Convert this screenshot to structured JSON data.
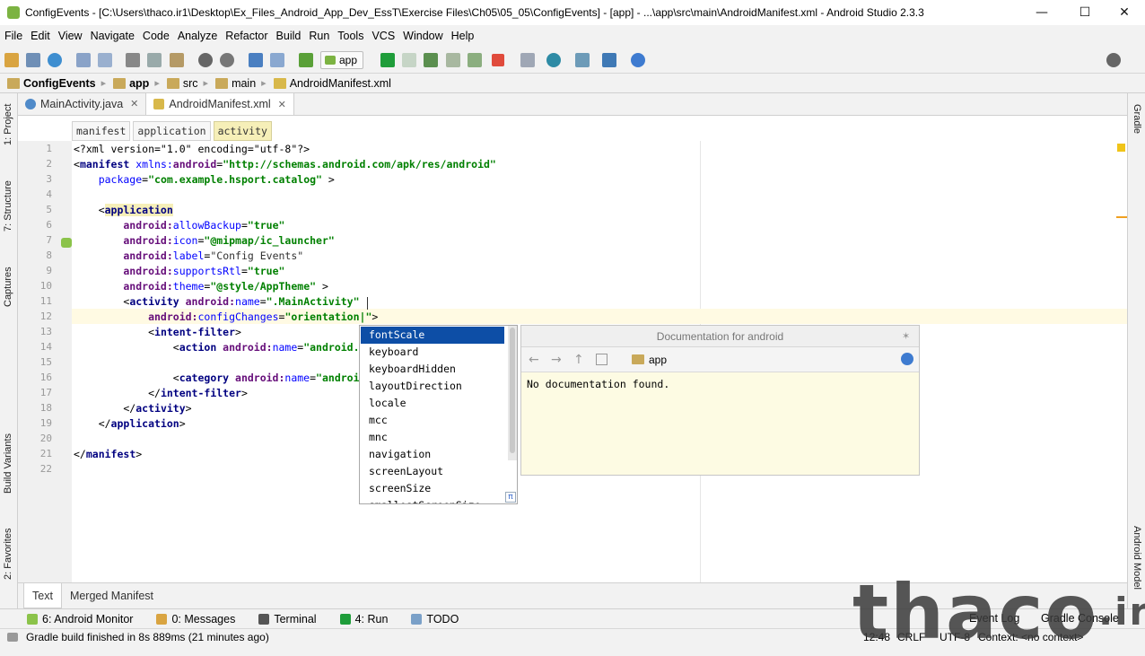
{
  "window": {
    "title": "ConfigEvents - [C:\\Users\\thaco.ir1\\Desktop\\Ex_Files_Android_App_Dev_EssT\\Exercise Files\\Ch05\\05_05\\ConfigEvents] - [app] - ...\\app\\src\\main\\AndroidManifest.xml - Android Studio 2.3.3",
    "minimize": "—",
    "maximize": "☐",
    "close": "✕"
  },
  "menu": [
    "File",
    "Edit",
    "View",
    "Navigate",
    "Code",
    "Analyze",
    "Refactor",
    "Build",
    "Run",
    "Tools",
    "VCS",
    "Window",
    "Help"
  ],
  "toolbar": {
    "run_config": "app"
  },
  "breadcrumbs": [
    "ConfigEvents",
    "app",
    "src",
    "main",
    "AndroidManifest.xml"
  ],
  "left_strip": {
    "project": "1: Project",
    "structure": "7: Structure",
    "captures": "Captures",
    "build_variants": "Build Variants",
    "favorites": "2: Favorites"
  },
  "right_strip": {
    "gradle": "Gradle",
    "android_model": "Android Model"
  },
  "editor_tabs": [
    {
      "label": "MainActivity.java",
      "active": false
    },
    {
      "label": "AndroidManifest.xml",
      "active": true
    }
  ],
  "xml_crumbs": [
    "manifest",
    "application",
    "activity"
  ],
  "line_numbers": [
    "1",
    "2",
    "3",
    "4",
    "5",
    "6",
    "7",
    "8",
    "9",
    "10",
    "11",
    "12",
    "13",
    "14",
    "15",
    "16",
    "17",
    "18",
    "19",
    "20",
    "21",
    "22"
  ],
  "code": {
    "l1a": "<?xml version=\"1.0\" encoding=\"utf-8\"?>",
    "l2a": "<",
    "l2b": "manifest",
    "l2c": " xmlns:",
    "l2d": "android",
    "l2e": "=",
    "l2f": "\"http://schemas.android.com/apk/res/android\"",
    "l3a": "    package",
    "l3b": "=",
    "l3c": "\"com.example.hsport.catalog\"",
    "l3d": " >",
    "l5a": "    <",
    "l5b": "application",
    "l6a": "        android:",
    "l6b": "allowBackup",
    "l6c": "=",
    "l6d": "\"true\"",
    "l7a": "        android:",
    "l7b": "icon",
    "l7c": "=",
    "l7d": "\"@mipmap/ic_launcher\"",
    "l8a": "        android:",
    "l8b": "label",
    "l8c": "=",
    "l8d": "\"Config Events\"",
    "l9a": "        android:",
    "l9b": "supportsRtl",
    "l9c": "=",
    "l9d": "\"true\"",
    "l10a": "        android:",
    "l10b": "theme",
    "l10c": "=",
    "l10d": "\"@style/AppTheme\"",
    "l10e": " >",
    "l11a": "        <",
    "l11b": "activity",
    "l11c": " android:",
    "l11d": "name",
    "l11e": "=",
    "l11f": "\".MainActivity\"",
    "l12a": "            android:",
    "l12b": "configChanges",
    "l12c": "=",
    "l12d": "\"orientation|\"",
    "l12e": ">",
    "l13a": "            <",
    "l13b": "intent-filter",
    "l13c": ">",
    "l14a": "                <",
    "l14b": "action",
    "l14c": " android:",
    "l14d": "name",
    "l14e": "=",
    "l14f": "\"android.",
    "l16a": "                <",
    "l16b": "category",
    "l16c": " android:",
    "l16d": "name",
    "l16e": "=",
    "l16f": "\"androi",
    "l17a": "            </",
    "l17b": "intent-filter",
    "l17c": ">",
    "l18a": "        </",
    "l18b": "activity",
    "l18c": ">",
    "l19a": "    </",
    "l19b": "application",
    "l19c": ">",
    "l21a": "</",
    "l21b": "manifest",
    "l21c": ">"
  },
  "completion": {
    "items": [
      "fontScale",
      "keyboard",
      "keyboardHidden",
      "layoutDirection",
      "locale",
      "mcc",
      "mnc",
      "navigation",
      "screenLayout",
      "screenSize",
      "smallestScreenSize"
    ],
    "selected": "fontScale",
    "badge": "π"
  },
  "doc_popup": {
    "title": "Documentation for android",
    "module": "app",
    "body": "No documentation found."
  },
  "bottom_tabs": [
    {
      "label": "Text",
      "active": true
    },
    {
      "label": "Merged Manifest",
      "active": false
    }
  ],
  "tool_windows": [
    {
      "label": "6: Android Monitor"
    },
    {
      "label": "0: Messages"
    },
    {
      "label": "Terminal"
    },
    {
      "label": "4: Run"
    },
    {
      "label": "TODO"
    }
  ],
  "right_tool_windows": [
    "Event Log",
    "Gradle Console"
  ],
  "status": {
    "message": "Gradle build finished in 8s 889ms (21 minutes ago)",
    "position": "12:48",
    "line_sep": "CRLF",
    "encoding": "UTF-8",
    "context": "Context: <no context>"
  },
  "watermark": {
    "text": "thaco",
    "suffix": ".ir"
  },
  "colors": {
    "tag": "#000080",
    "attr": "#0000ff",
    "value": "#008000",
    "selection": "#0d4ea6",
    "doc_bg": "#fdfbe3"
  }
}
